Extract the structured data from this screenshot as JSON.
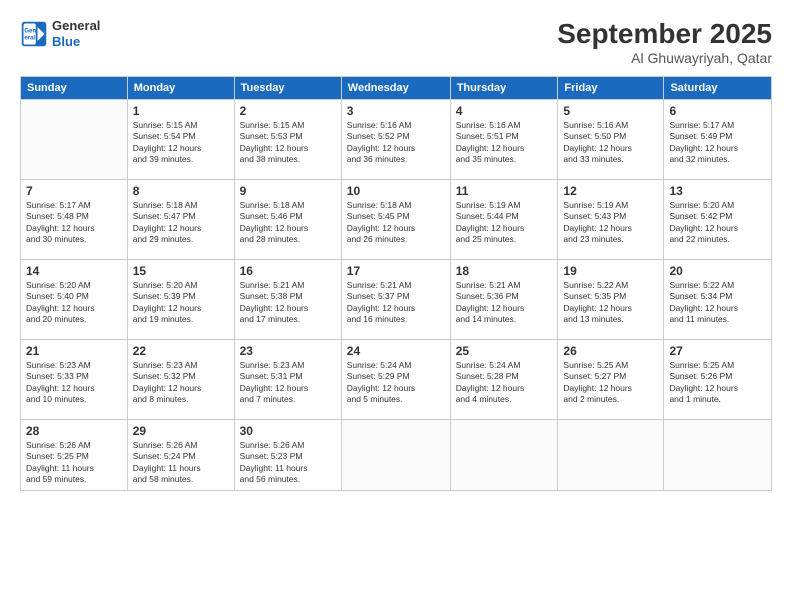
{
  "header": {
    "logo_line1": "General",
    "logo_line2": "Blue",
    "month": "September 2025",
    "location": "Al Ghuwayriyah, Qatar"
  },
  "weekdays": [
    "Sunday",
    "Monday",
    "Tuesday",
    "Wednesday",
    "Thursday",
    "Friday",
    "Saturday"
  ],
  "weeks": [
    [
      {
        "day": "",
        "info": ""
      },
      {
        "day": "1",
        "info": "Sunrise: 5:15 AM\nSunset: 5:54 PM\nDaylight: 12 hours\nand 39 minutes."
      },
      {
        "day": "2",
        "info": "Sunrise: 5:15 AM\nSunset: 5:53 PM\nDaylight: 12 hours\nand 38 minutes."
      },
      {
        "day": "3",
        "info": "Sunrise: 5:16 AM\nSunset: 5:52 PM\nDaylight: 12 hours\nand 36 minutes."
      },
      {
        "day": "4",
        "info": "Sunrise: 5:16 AM\nSunset: 5:51 PM\nDaylight: 12 hours\nand 35 minutes."
      },
      {
        "day": "5",
        "info": "Sunrise: 5:16 AM\nSunset: 5:50 PM\nDaylight: 12 hours\nand 33 minutes."
      },
      {
        "day": "6",
        "info": "Sunrise: 5:17 AM\nSunset: 5:49 PM\nDaylight: 12 hours\nand 32 minutes."
      }
    ],
    [
      {
        "day": "7",
        "info": "Sunrise: 5:17 AM\nSunset: 5:48 PM\nDaylight: 12 hours\nand 30 minutes."
      },
      {
        "day": "8",
        "info": "Sunrise: 5:18 AM\nSunset: 5:47 PM\nDaylight: 12 hours\nand 29 minutes."
      },
      {
        "day": "9",
        "info": "Sunrise: 5:18 AM\nSunset: 5:46 PM\nDaylight: 12 hours\nand 28 minutes."
      },
      {
        "day": "10",
        "info": "Sunrise: 5:18 AM\nSunset: 5:45 PM\nDaylight: 12 hours\nand 26 minutes."
      },
      {
        "day": "11",
        "info": "Sunrise: 5:19 AM\nSunset: 5:44 PM\nDaylight: 12 hours\nand 25 minutes."
      },
      {
        "day": "12",
        "info": "Sunrise: 5:19 AM\nSunset: 5:43 PM\nDaylight: 12 hours\nand 23 minutes."
      },
      {
        "day": "13",
        "info": "Sunrise: 5:20 AM\nSunset: 5:42 PM\nDaylight: 12 hours\nand 22 minutes."
      }
    ],
    [
      {
        "day": "14",
        "info": "Sunrise: 5:20 AM\nSunset: 5:40 PM\nDaylight: 12 hours\nand 20 minutes."
      },
      {
        "day": "15",
        "info": "Sunrise: 5:20 AM\nSunset: 5:39 PM\nDaylight: 12 hours\nand 19 minutes."
      },
      {
        "day": "16",
        "info": "Sunrise: 5:21 AM\nSunset: 5:38 PM\nDaylight: 12 hours\nand 17 minutes."
      },
      {
        "day": "17",
        "info": "Sunrise: 5:21 AM\nSunset: 5:37 PM\nDaylight: 12 hours\nand 16 minutes."
      },
      {
        "day": "18",
        "info": "Sunrise: 5:21 AM\nSunset: 5:36 PM\nDaylight: 12 hours\nand 14 minutes."
      },
      {
        "day": "19",
        "info": "Sunrise: 5:22 AM\nSunset: 5:35 PM\nDaylight: 12 hours\nand 13 minutes."
      },
      {
        "day": "20",
        "info": "Sunrise: 5:22 AM\nSunset: 5:34 PM\nDaylight: 12 hours\nand 11 minutes."
      }
    ],
    [
      {
        "day": "21",
        "info": "Sunrise: 5:23 AM\nSunset: 5:33 PM\nDaylight: 12 hours\nand 10 minutes."
      },
      {
        "day": "22",
        "info": "Sunrise: 5:23 AM\nSunset: 5:32 PM\nDaylight: 12 hours\nand 8 minutes."
      },
      {
        "day": "23",
        "info": "Sunrise: 5:23 AM\nSunset: 5:31 PM\nDaylight: 12 hours\nand 7 minutes."
      },
      {
        "day": "24",
        "info": "Sunrise: 5:24 AM\nSunset: 5:29 PM\nDaylight: 12 hours\nand 5 minutes."
      },
      {
        "day": "25",
        "info": "Sunrise: 5:24 AM\nSunset: 5:28 PM\nDaylight: 12 hours\nand 4 minutes."
      },
      {
        "day": "26",
        "info": "Sunrise: 5:25 AM\nSunset: 5:27 PM\nDaylight: 12 hours\nand 2 minutes."
      },
      {
        "day": "27",
        "info": "Sunrise: 5:25 AM\nSunset: 5:26 PM\nDaylight: 12 hours\nand 1 minute."
      }
    ],
    [
      {
        "day": "28",
        "info": "Sunrise: 5:26 AM\nSunset: 5:25 PM\nDaylight: 11 hours\nand 59 minutes."
      },
      {
        "day": "29",
        "info": "Sunrise: 5:26 AM\nSunset: 5:24 PM\nDaylight: 11 hours\nand 58 minutes."
      },
      {
        "day": "30",
        "info": "Sunrise: 5:26 AM\nSunset: 5:23 PM\nDaylight: 11 hours\nand 56 minutes."
      },
      {
        "day": "",
        "info": ""
      },
      {
        "day": "",
        "info": ""
      },
      {
        "day": "",
        "info": ""
      },
      {
        "day": "",
        "info": ""
      }
    ]
  ]
}
